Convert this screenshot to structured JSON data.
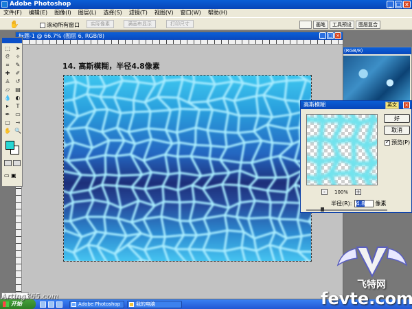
{
  "app": {
    "title": "Adobe Photoshop"
  },
  "menu": [
    "文件(F)",
    "编辑(E)",
    "图像(I)",
    "图层(L)",
    "选择(S)",
    "滤镜(T)",
    "视图(V)",
    "窗口(W)",
    "帮助(H)"
  ],
  "options": {
    "checkbox_label": "滚动所有窗口",
    "buttons": [
      "实际像素",
      "满画布显示",
      "打印尺寸"
    ],
    "palette_tabs": [
      "画笔",
      "工具预设",
      "图层复合"
    ]
  },
  "document": {
    "title": "标题-1 @ 66.7% (图层 6, RGB/8)"
  },
  "step_label": "14. 高斯模糊，半径4.8像素",
  "navigator": {
    "title": "(RGB/8)"
  },
  "dialog": {
    "title": "高斯模糊",
    "badge": "英文",
    "ok": "好",
    "cancel": "取消",
    "preview_label": "预览(P)",
    "zoom_value": "100%",
    "zoom_minus": "-",
    "zoom_plus": "+",
    "radius_label": "半径(R):",
    "radius_value": "4.8",
    "radius_unit": "像素",
    "radius_slider_fraction": 0.18
  },
  "toolbox": {
    "fg_color": "#27d6d4",
    "bg_color": "#ffffff"
  },
  "taskbar": {
    "start": "开始",
    "tasks": [
      {
        "label": "Adobe Photoshop",
        "icon": "photoshop-icon"
      },
      {
        "label": "我的电脑",
        "icon": "folder-icon"
      }
    ]
  },
  "watermarks": {
    "left": "Arting365.com",
    "cn": "飞特网",
    "en": "fevte.com"
  }
}
